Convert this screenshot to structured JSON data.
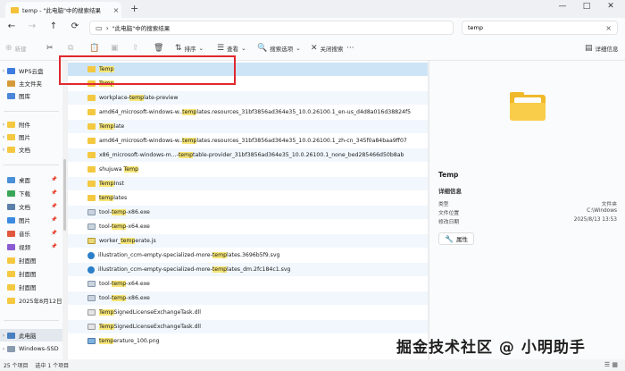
{
  "title_bar": {
    "tab_title": "temp - \"此电脑\"中的搜索结果",
    "new_tab": "+",
    "close_tab": "×",
    "window_controls": [
      "—",
      "□",
      "✕"
    ]
  },
  "address_bar": {
    "nav": [
      "←",
      "→",
      "↑",
      "⟳"
    ],
    "path": "\"此电脑\"中的搜索结果",
    "search_value": "temp",
    "search_clear": "×"
  },
  "toolbar": {
    "new_label": "新建",
    "sort_label": "排序",
    "view_label": "查看",
    "search_options_label": "搜索选项",
    "close_search_label": "关闭搜索",
    "details_label": "详细信息",
    "more": "···"
  },
  "sidebar": {
    "items": [
      {
        "label": "WPS云盘",
        "chev": "›",
        "icon": "cloud-icon",
        "color": "#3d7be0"
      },
      {
        "label": "主文件夹",
        "chev": "",
        "icon": "home-icon",
        "color": "#d49a3a"
      },
      {
        "label": "图库",
        "chev": "",
        "icon": "gallery-icon",
        "color": "#4a86d9"
      },
      {
        "label": "附件",
        "chev": "›",
        "icon": "folder-icon",
        "color": "#f4c840"
      },
      {
        "label": "图片",
        "chev": "›",
        "icon": "folder-icon",
        "color": "#f4c840"
      },
      {
        "label": "文档",
        "chev": "›",
        "icon": "folder-icon",
        "color": "#f4c840"
      },
      {
        "label": "桌面",
        "chev": "",
        "icon": "desktop-icon",
        "color": "#4a90d9",
        "pin": "📌"
      },
      {
        "label": "下载",
        "chev": "",
        "icon": "download-icon",
        "color": "#3aa657",
        "pin": "📌"
      },
      {
        "label": "文档",
        "chev": "",
        "icon": "documents-icon",
        "color": "#5b7fa8",
        "pin": "📌"
      },
      {
        "label": "图片",
        "chev": "",
        "icon": "pictures-icon",
        "color": "#3d8be0",
        "pin": "📌"
      },
      {
        "label": "音乐",
        "chev": "",
        "icon": "music-icon",
        "color": "#e2573e",
        "pin": "📌"
      },
      {
        "label": "视频",
        "chev": "",
        "icon": "video-icon",
        "color": "#8a5bd1",
        "pin": "📌"
      },
      {
        "label": "封面图",
        "chev": "",
        "icon": "folder-icon",
        "color": "#f4c840"
      },
      {
        "label": "封面图",
        "chev": "",
        "icon": "folder-icon",
        "color": "#f4c840"
      },
      {
        "label": "封面图",
        "chev": "",
        "icon": "folder-icon",
        "color": "#f4c840"
      },
      {
        "label": "2025年8月12日",
        "chev": "",
        "icon": "folder-icon",
        "color": "#f4c840"
      },
      {
        "label": "此电脑",
        "chev": "›",
        "icon": "pc-icon",
        "color": "#4a7fc1"
      },
      {
        "label": "Windows-SSD",
        "chev": "›",
        "icon": "drive-icon",
        "color": "#8a9bb0"
      }
    ]
  },
  "files": [
    {
      "name": "Temp",
      "hl": "Temp",
      "type": "folder"
    },
    {
      "name": "Temp",
      "hl": "Temp",
      "type": "folder"
    },
    {
      "name": "workplace-template-preview",
      "hl": "temp",
      "type": "folder"
    },
    {
      "name": "amd64_microsoft-windows-w..templates.resources_31bf3856ad364e35_10.0.26100.1_en-us_d4d8a016d38824f5",
      "hl": "temp",
      "type": "folder"
    },
    {
      "name": "Template",
      "hl": "Temp",
      "type": "folder"
    },
    {
      "name": "amd64_microsoft-windows-w..templates.resources_31bf3856ad364e35_10.0.26100.1_zh-cn_345f0a84baa9ff07",
      "hl": "temp",
      "type": "folder"
    },
    {
      "name": "x86_microsoft-windows-m...-temptable-provider_31bf3856ad364e35_10.0.26100.1_none_bed285466d50b8ab",
      "hl": "temp",
      "type": "folder"
    },
    {
      "name": "shujuwa Temp",
      "hl": "Temp",
      "type": "folder"
    },
    {
      "name": "TempInst",
      "hl": "Temp",
      "type": "folder"
    },
    {
      "name": "templates",
      "hl": "temp",
      "type": "folder"
    },
    {
      "name": "tool-temp-x86.exe",
      "hl": "temp",
      "type": "exe"
    },
    {
      "name": "tool-temp-x64.exe",
      "hl": "temp",
      "type": "exe"
    },
    {
      "name": "worker_temperate.js",
      "hl": "temp",
      "type": "js"
    },
    {
      "name": "illustration_ccm-empty-specialized-more-templates.3696b5f9.svg",
      "hl": "temp",
      "type": "svg"
    },
    {
      "name": "illustration_ccm-empty-specialized-more-templates_dm.2fc184c1.svg",
      "hl": "temp",
      "type": "svg"
    },
    {
      "name": "tool-temp-x64.exe",
      "hl": "temp",
      "type": "exe"
    },
    {
      "name": "tool-temp-x86.exe",
      "hl": "temp",
      "type": "exe"
    },
    {
      "name": "TempSignedLicenseExchangeTask.dll",
      "hl": "Temp",
      "type": "dll"
    },
    {
      "name": "TempSignedLicenseExchangeTask.dll",
      "hl": "Temp",
      "type": "dll"
    },
    {
      "name": "temperature_100.png",
      "hl": "temp",
      "type": "png"
    }
  ],
  "details": {
    "title": "Temp",
    "section": "详细信息",
    "rows": [
      {
        "k": "类型",
        "v": "文件夹"
      },
      {
        "k": "文件位置",
        "v": "C:\\Windows"
      },
      {
        "k": "修改日期",
        "v": "2025/8/13 13:53"
      }
    ],
    "properties_label": "属性"
  },
  "status": {
    "count": "25 个项目",
    "selected": "选中 1 个项目"
  },
  "watermark": "掘金技术社区 @ 小明助手"
}
